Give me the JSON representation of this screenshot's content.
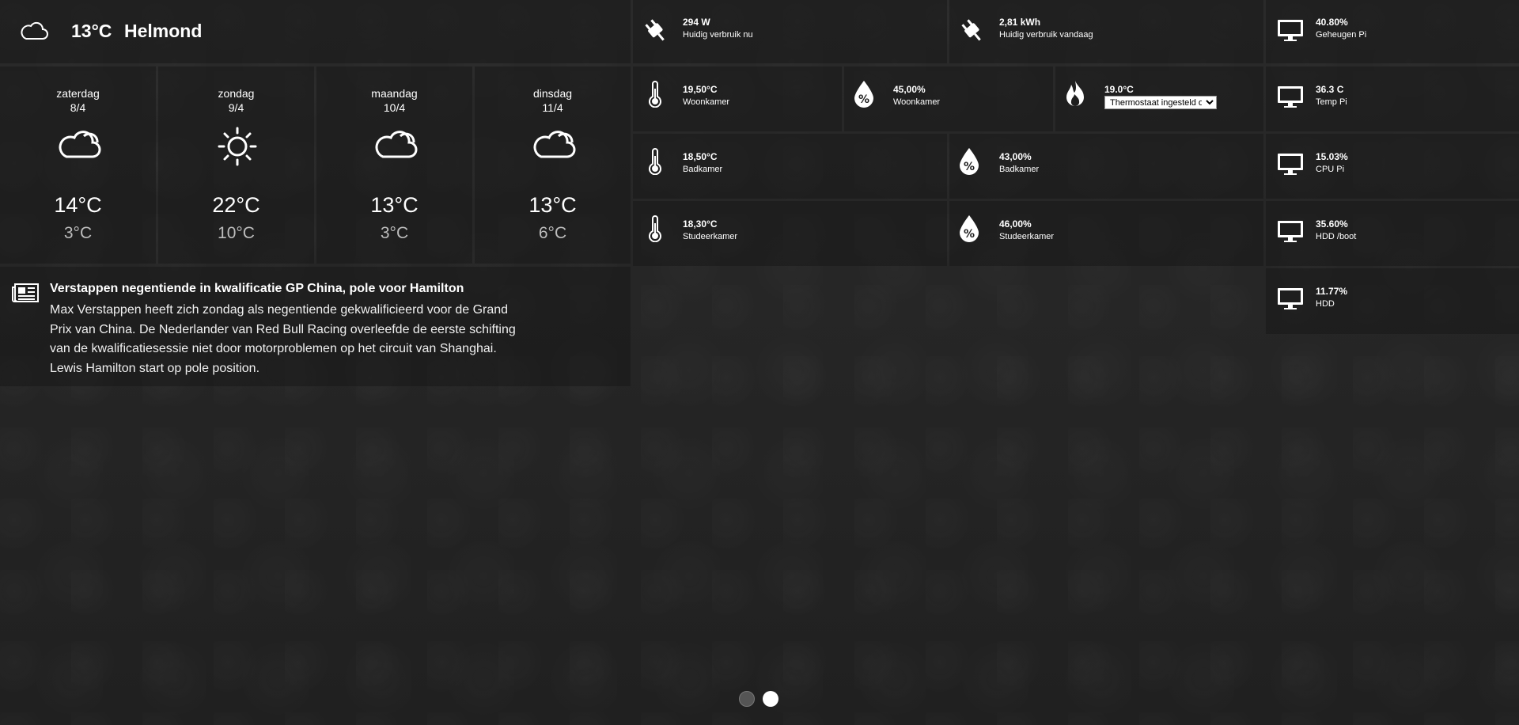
{
  "weather": {
    "current": {
      "icon": "cloud-icon",
      "temp": "13°C",
      "city": "Helmond"
    },
    "days": [
      {
        "name": "zaterdag",
        "date": "8/4",
        "icon": "cloud-icon",
        "max": "14°C",
        "min": "3°C"
      },
      {
        "name": "zondag",
        "date": "9/4",
        "icon": "sun-icon",
        "max": "22°C",
        "min": "10°C"
      },
      {
        "name": "maandag",
        "date": "10/4",
        "icon": "cloud-icon",
        "max": "13°C",
        "min": "3°C"
      },
      {
        "name": "dinsdag",
        "date": "11/4",
        "icon": "cloud-icon",
        "max": "13°C",
        "min": "6°C"
      }
    ]
  },
  "news": {
    "icon": "newspaper-icon",
    "title": "Verstappen negentiende in kwalificatie GP China, pole voor Hamilton",
    "lines": [
      "Max Verstappen heeft zich zondag als negentiende gekwalificieerd voor de Grand",
      "Prix van China. De Nederlander van Red Bull Racing overleefde de eerste schifting",
      "van de kwalificatiesessie niet door motorproblemen op het circuit van Shanghai.",
      "Lewis Hamilton start op pole position."
    ]
  },
  "energy": {
    "now": {
      "icon": "plug-icon",
      "value": "294 W",
      "label": "Huidig verbruik nu"
    },
    "today": {
      "icon": "plug-icon",
      "value": "2,81 kWh",
      "label": "Huidig verbruik vandaag"
    }
  },
  "climate": {
    "woonkamer_temp": {
      "icon": "thermometer-icon",
      "value": "19,50°C",
      "label": "Woonkamer"
    },
    "woonkamer_hum": {
      "icon": "humidity-icon",
      "value": "45,00%",
      "label": "Woonkamer"
    },
    "thermostat": {
      "icon": "flame-icon",
      "value": "19.0°C",
      "select_value": "Thermostaat ingesteld op"
    },
    "badkamer_temp": {
      "icon": "thermometer-icon",
      "value": "18,50°C",
      "label": "Badkamer"
    },
    "badkamer_hum": {
      "icon": "humidity-icon",
      "value": "43,00%",
      "label": "Badkamer"
    },
    "studeer_temp": {
      "icon": "thermometer-icon",
      "value": "18,30°C",
      "label": "Studeerkamer"
    },
    "studeer_hum": {
      "icon": "humidity-icon",
      "value": "46,00%",
      "label": "Studeerkamer"
    }
  },
  "system": [
    {
      "icon": "monitor-icon",
      "value": "40.80%",
      "label": "Geheugen Pi"
    },
    {
      "icon": "monitor-icon",
      "value": "36.3 C",
      "label": "Temp Pi"
    },
    {
      "icon": "monitor-icon",
      "value": "15.03%",
      "label": "CPU Pi"
    },
    {
      "icon": "monitor-icon",
      "value": "35.60%",
      "label": "HDD /boot"
    },
    {
      "icon": "monitor-icon",
      "value": "11.77%",
      "label": "HDD"
    }
  ],
  "pager": {
    "pages": 2,
    "active": 2,
    "colors": {
      "inactive": "#555555",
      "active": "#ffffff"
    }
  }
}
